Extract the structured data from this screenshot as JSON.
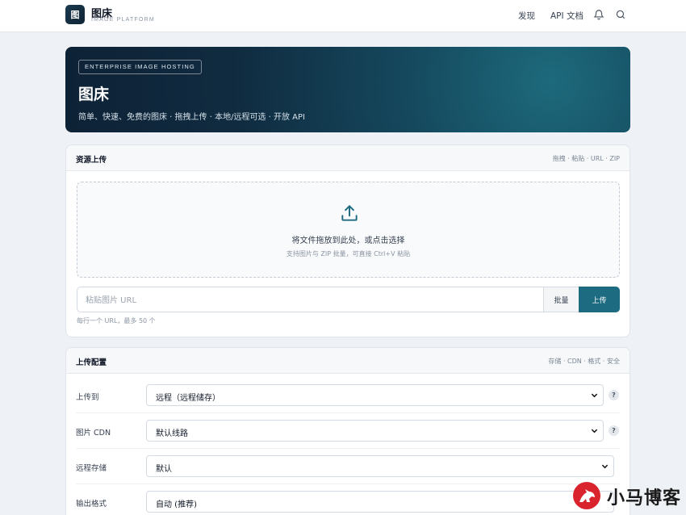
{
  "brand": {
    "logo_char": "图",
    "name": "图床",
    "subtitle": "IMAGE PLATFORM"
  },
  "nav": {
    "discover": "发现",
    "api_docs": "API 文档",
    "icons": [
      "bell-icon",
      "search-icon"
    ]
  },
  "hero": {
    "badge": "ENTERPRISE IMAGE HOSTING",
    "title": "图床",
    "description": "简单、快速、免费的图床 · 拖拽上传 · 本地/远程可选 · 开放 API"
  },
  "upload_card": {
    "title": "资源上传",
    "meta": "拖拽 · 粘贴 · URL · ZIP",
    "drop_main": "将文件拖放到此处，或点击选择",
    "drop_sub": "支持图片与 ZIP 批量，可直接 Ctrl+V 粘贴",
    "url_placeholder": "粘贴图片 URL",
    "batch_label": "批量",
    "upload_label": "上传",
    "hint": "每行一个 URL，最多 50 个"
  },
  "config_card": {
    "title": "上传配置",
    "meta": "存储 · CDN · 格式 · 安全",
    "rows": [
      {
        "label": "上传到",
        "value": "远程（远程储存）",
        "help": "?"
      },
      {
        "label": "图片 CDN",
        "value": "默认线路",
        "help": "?"
      },
      {
        "label": "远程存储",
        "value": "默认"
      },
      {
        "label": "输出格式",
        "value": "自动 (推荐)"
      }
    ]
  },
  "watermark": {
    "text": "小马博客"
  },
  "colors": {
    "accent": "#1d6b80",
    "hero_dark": "#0e2236",
    "page_bg": "#eef1f5"
  }
}
